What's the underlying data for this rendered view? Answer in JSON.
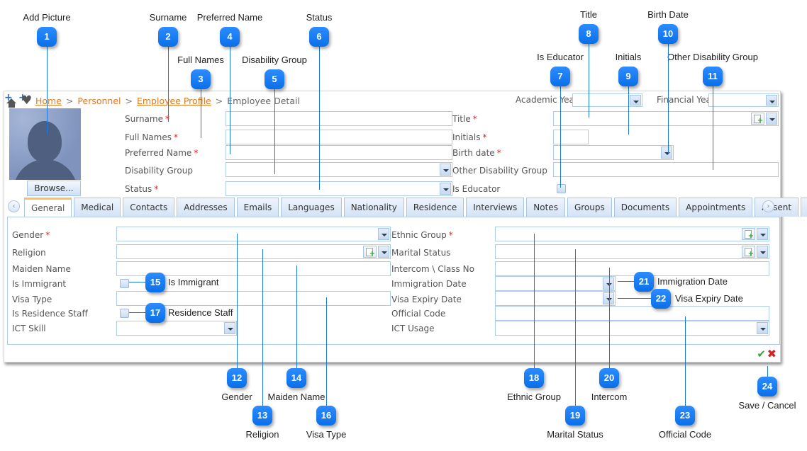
{
  "breadcrumb": {
    "items": [
      "Home",
      "Personnel",
      "Employee Profile",
      "Employee Detail"
    ],
    "separator": ">"
  },
  "header": {
    "academic_year_label": "Academic Year",
    "financial_year_label": "Financial Year"
  },
  "photo": {
    "browse_label": "Browse..."
  },
  "left_form": {
    "surname": "Surname",
    "full_names": "Full Names",
    "preferred_name": "Preferred Name",
    "disability_group": "Disability Group",
    "status": "Status"
  },
  "right_form": {
    "title": "Title",
    "initials": "Initials",
    "birth_date": "Birth date",
    "other_disability_group": "Other Disability Group",
    "is_educator": "Is Educator"
  },
  "required_marker": "*",
  "tabs": [
    "General",
    "Medical",
    "Contacts",
    "Addresses",
    "Emails",
    "Languages",
    "Nationality",
    "Residence",
    "Interviews",
    "Notes",
    "Groups",
    "Documents",
    "Appointments",
    "Absent"
  ],
  "active_tab": "General",
  "tab_nav": {
    "prev": "‹",
    "next": "›"
  },
  "general": {
    "gender": "Gender",
    "religion": "Religion",
    "maiden_name": "Maiden Name",
    "is_immigrant": "Is Immigrant",
    "visa_type": "Visa Type",
    "is_residence_staff": "Is Residence Staff",
    "ict_skill": "ICT Skill",
    "ethnic_group": "Ethnic Group",
    "marital_status": "Marital Status",
    "intercom": "Intercom \\ Class No",
    "immigration_date": "Immigration Date",
    "visa_expiry_date": "Visa Expiry Date",
    "official_code": "Official Code",
    "ict_usage": "ICT Usage"
  },
  "actions": {
    "save": "✔",
    "cancel": "✖"
  },
  "callouts": [
    {
      "n": "1",
      "label": "Add Picture"
    },
    {
      "n": "2",
      "label": "Surname"
    },
    {
      "n": "3",
      "label": "Full Names"
    },
    {
      "n": "4",
      "label": "Preferred Name"
    },
    {
      "n": "5",
      "label": "Disability Group"
    },
    {
      "n": "6",
      "label": "Status"
    },
    {
      "n": "7",
      "label": "Is Educator"
    },
    {
      "n": "8",
      "label": "Title"
    },
    {
      "n": "9",
      "label": "Initials"
    },
    {
      "n": "10",
      "label": "Birth Date"
    },
    {
      "n": "11",
      "label": "Other Disability Group"
    },
    {
      "n": "12",
      "label": "Gender"
    },
    {
      "n": "13",
      "label": "Religion"
    },
    {
      "n": "14",
      "label": "Maiden Name"
    },
    {
      "n": "15",
      "label": "Is Immigrant"
    },
    {
      "n": "16",
      "label": "Visa Type"
    },
    {
      "n": "17",
      "label": "Residence Staff"
    },
    {
      "n": "18",
      "label": "Ethnic Group"
    },
    {
      "n": "19",
      "label": "Marital Status"
    },
    {
      "n": "20",
      "label": "Intercom"
    },
    {
      "n": "21",
      "label": "Immigration Date"
    },
    {
      "n": "22",
      "label": "Visa Expiry Date"
    },
    {
      "n": "23",
      "label": "Official Code"
    },
    {
      "n": "24",
      "label": "Save / Cancel"
    }
  ]
}
